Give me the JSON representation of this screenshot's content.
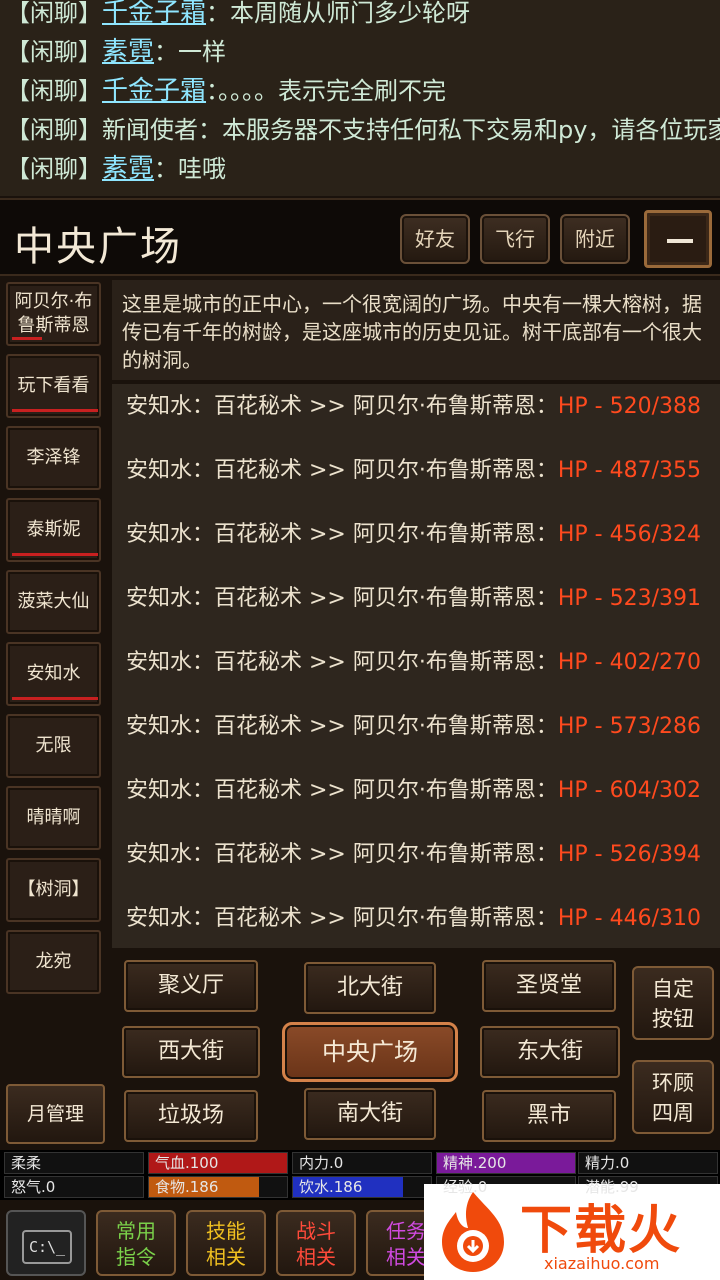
{
  "chat": [
    {
      "tag": "【闲聊】",
      "who": "千金子霜",
      "link": true,
      "msg": "：本周随从师门多少轮呀"
    },
    {
      "tag": "【闲聊】",
      "who": "素霓",
      "link": true,
      "msg": "：一样"
    },
    {
      "tag": "【闲聊】",
      "who": "千金子霜",
      "link": true,
      "msg": "：。。。。表示完全刷不完"
    },
    {
      "tag": "【闲聊】",
      "who": "新闻使者",
      "link": false,
      "msg": "：本服务器不支持任何私下交易和py，请各位玩家"
    },
    {
      "tag": "【闲聊】",
      "who": "素霓",
      "link": true,
      "msg": "：哇哦"
    }
  ],
  "location": {
    "title": "中央广场",
    "description": "这里是城市的正中心，一个很宽阔的广场。中央有一棵大榕树，据传已有千年的树龄，是这座城市的历史见证。树干底部有一个很大的树洞。"
  },
  "top_buttons": {
    "friends": "好友",
    "fly": "飞行",
    "nearby": "附近"
  },
  "npcs": [
    {
      "name": "阿贝尔·布鲁斯蒂恩",
      "hp": 0.35
    },
    {
      "name": "玩下看看",
      "hp": 1.0
    },
    {
      "name": "李泽锋",
      "hp": 0
    },
    {
      "name": "泰斯妮",
      "hp": 1.0
    },
    {
      "name": "菠菜大仙",
      "hp": 0
    },
    {
      "name": "安知水",
      "hp": 1.0
    },
    {
      "name": "无限",
      "hp": 0
    },
    {
      "name": "晴晴啊",
      "hp": 0
    },
    {
      "name": "【树洞】",
      "hp": 0
    },
    {
      "name": "龙宛",
      "hp": 0
    }
  ],
  "log": [
    {
      "text": "安知水：百花秘术 >> 阿贝尔·布鲁斯蒂恩：",
      "hp": "HP - 520/388"
    },
    {
      "text": "安知水：百花秘术 >> 阿贝尔·布鲁斯蒂恩：",
      "hp": "HP - 487/355"
    },
    {
      "text": "安知水：百花秘术 >> 阿贝尔·布鲁斯蒂恩：",
      "hp": "HP - 456/324"
    },
    {
      "text": "安知水：百花秘术 >> 阿贝尔·布鲁斯蒂恩：",
      "hp": "HP - 523/391"
    },
    {
      "text": "安知水：百花秘术 >> 阿贝尔·布鲁斯蒂恩：",
      "hp": "HP - 402/270"
    },
    {
      "text": "安知水：百花秘术 >> 阿贝尔·布鲁斯蒂恩：",
      "hp": "HP - 573/286"
    },
    {
      "text": "安知水：百花秘术 >> 阿贝尔·布鲁斯蒂恩：",
      "hp": "HP - 604/302"
    },
    {
      "text": "安知水：百花秘术 >> 阿贝尔·布鲁斯蒂恩：",
      "hp": "HP - 526/394"
    },
    {
      "text": "安知水：百花秘术 >> 阿贝尔·布鲁斯蒂恩：",
      "hp": "HP - 446/310"
    }
  ],
  "map": {
    "nw": "聚义厅",
    "n": "北大街",
    "ne": "圣贤堂",
    "w": "西大街",
    "center": "中央广场",
    "e": "东大街",
    "sw": "垃圾场",
    "s": "南大街",
    "se": "黑市"
  },
  "side": {
    "custom": "自定按钮",
    "lookaround": "环顾四周"
  },
  "month_manage": "月管理",
  "stats": [
    {
      "label": "柔柔",
      "fill": 0,
      "color": "#111111"
    },
    {
      "label": "气血.100",
      "fill": 1.0,
      "color": "#b01818"
    },
    {
      "label": "内力.0",
      "fill": 0,
      "color": "#111111"
    },
    {
      "label": "精神.200",
      "fill": 1.0,
      "color": "#7a1a9a"
    },
    {
      "label": "精力.0",
      "fill": 0,
      "color": "#111111"
    },
    {
      "label": "怒气.0",
      "fill": 0,
      "color": "#111111"
    },
    {
      "label": "食物.186",
      "fill": 0.8,
      "color": "#c05a10"
    },
    {
      "label": "饮水.186",
      "fill": 0.8,
      "color": "#2030c0"
    },
    {
      "label": "经验.0",
      "fill": 0,
      "color": "#111111"
    },
    {
      "label": "潜能.99",
      "fill": 0,
      "color": "#111111"
    }
  ],
  "bottom": [
    {
      "label": "常用指令",
      "color": "#7ad14a"
    },
    {
      "label": "技能相关",
      "color": "#f0c020"
    },
    {
      "label": "战斗相关",
      "color": "#ff4a3a"
    },
    {
      "label": "任务相关",
      "color": "#d04ae0"
    }
  ],
  "console_label": "C:\\_",
  "watermark": {
    "text": "下载火",
    "url": "xiazaihuo.com"
  }
}
